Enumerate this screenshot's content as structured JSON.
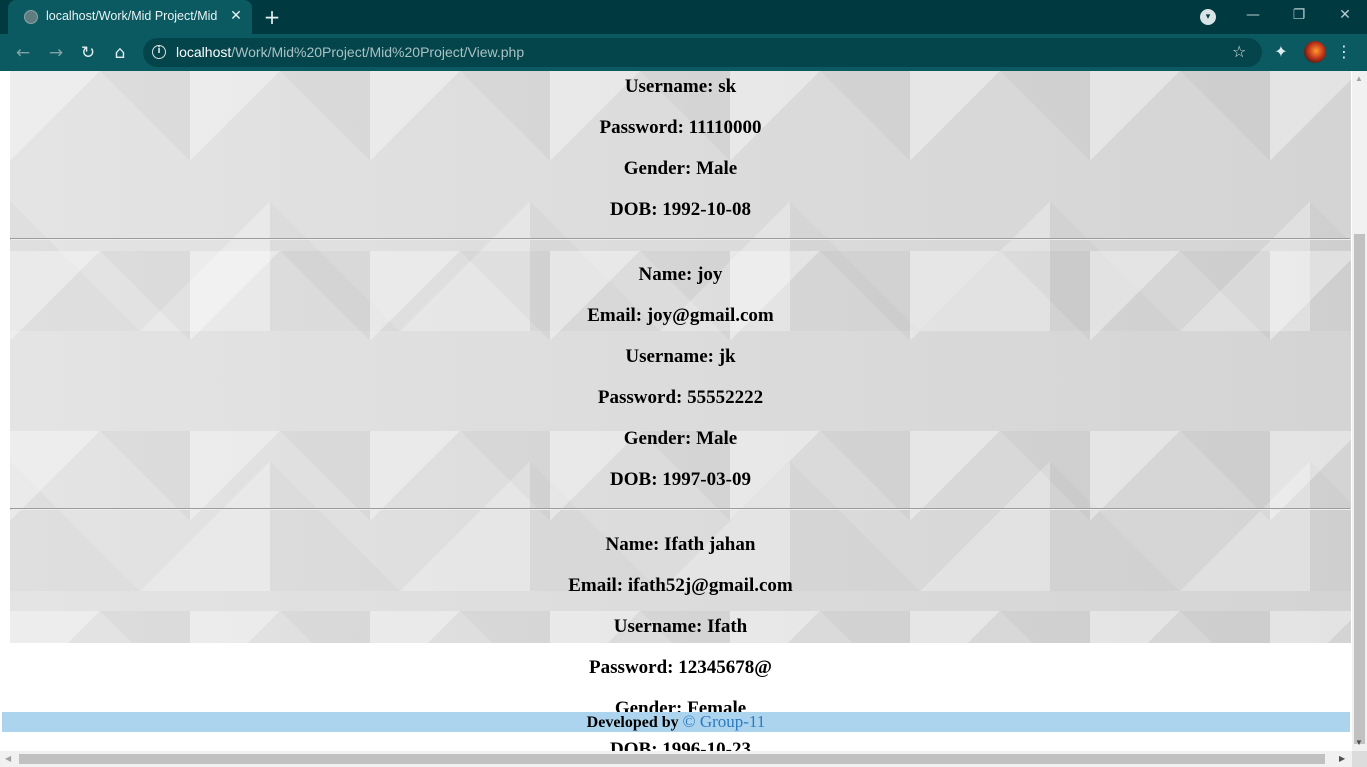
{
  "browser": {
    "tab_title": "localhost/Work/Mid Project/Mid",
    "tab_close": "✕",
    "new_tab": "+",
    "url_host": "localhost",
    "url_path": "/Work/Mid%20Project/Mid%20Project/View.php",
    "icons": [
      "globe-icon",
      "back-icon",
      "forward-icon",
      "reload-icon",
      "home-icon",
      "info-icon",
      "star-icon",
      "extensions-icon",
      "avatar",
      "menu-icon",
      "tab-search-icon"
    ],
    "window_controls": {
      "minimize": "—",
      "restore": "❐",
      "close": "✕"
    }
  },
  "records": [
    {
      "lines": [
        {
          "label": "Username:",
          "value": "sk"
        },
        {
          "label": "Password:",
          "value": "11110000"
        },
        {
          "label": "Gender:",
          "value": "Male"
        },
        {
          "label": "DOB:",
          "value": "1992-10-08"
        }
      ]
    },
    {
      "lines": [
        {
          "label": "Name:",
          "value": "joy"
        },
        {
          "label": "Email:",
          "value": "joy@gmail.com"
        },
        {
          "label": "Username:",
          "value": "jk"
        },
        {
          "label": "Password:",
          "value": "55552222"
        },
        {
          "label": "Gender:",
          "value": "Male"
        },
        {
          "label": "DOB:",
          "value": "1997-03-09"
        }
      ]
    },
    {
      "lines": [
        {
          "label": "Name:",
          "value": "Ifath jahan"
        },
        {
          "label": "Email:",
          "value": "ifath52j@gmail.com"
        },
        {
          "label": "Username:",
          "value": "Ifath"
        },
        {
          "label": "Password:",
          "value": "12345678@"
        },
        {
          "label": "Gender:",
          "value": "Female"
        },
        {
          "label": "DOB:",
          "value": "1996-10-23"
        }
      ]
    }
  ],
  "footer": {
    "developed_by": "Developed by",
    "group": "© Group-11",
    "bg_color": "#acd4ee",
    "link_color": "#2c7ac0"
  }
}
